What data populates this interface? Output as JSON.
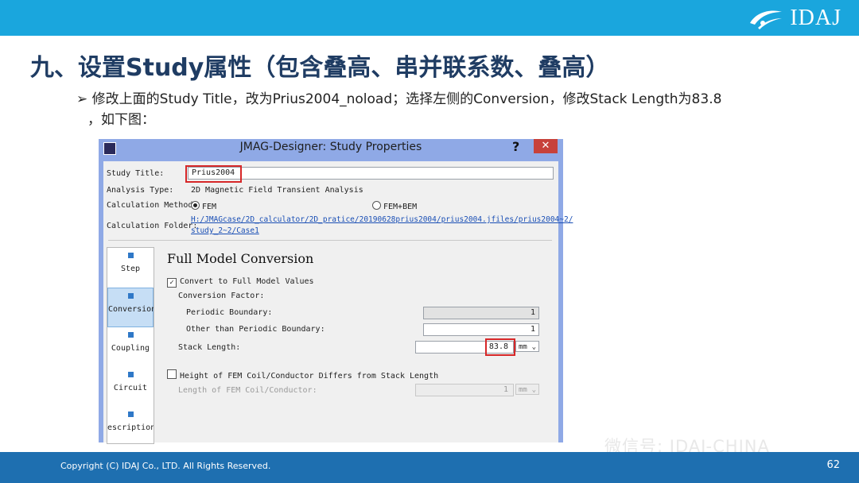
{
  "brand": {
    "logo_text": "IDAJ",
    "logo_icon": "idaj-swoosh-icon"
  },
  "slide": {
    "title": "九、设置Study属性（包含叠高、串并联系数、叠高）",
    "bullet_marker": "➢",
    "bullet_line1": "修改上面的Study Title，改为Prius2004_noload；选择左侧的Conversion，修改Stack Length为83.8",
    "bullet_line2": "，如下图："
  },
  "dialog": {
    "title": "JMAG-Designer: Study Properties",
    "help_label": "?",
    "close_label": "✕",
    "study_title_label": "Study Title:",
    "study_title_value": "Prius2004",
    "analysis_type_label": "Analysis Type:",
    "analysis_type_value": "2D Magnetic Field Transient Analysis",
    "calc_method_label": "Calculation Method:",
    "method_fem": "FEM",
    "method_fem_bem": "FEM+BEM",
    "calc_folder_label": "Calculation Folder:",
    "calc_folder_line1": "H:/JMAGcase/2D_calculator/2D_pratice/20190628prius2004/prius2004.jfiles/prius2004~2/",
    "calc_folder_line2": "study_2~2/Case1",
    "nav_items": [
      "Step",
      "Conversion",
      "Coupling",
      "Circuit",
      "Description"
    ],
    "nav_active": "Conversion",
    "panel": {
      "title": "Full Model Conversion",
      "convert_label": "Convert to Full Model Values",
      "convert_checked": true,
      "conversion_factor_label": "Conversion Factor:",
      "periodic_label": "Periodic Boundary:",
      "periodic_value": "1",
      "other_label": "Other than Periodic Boundary:",
      "other_value": "1",
      "stack_label": "Stack Length:",
      "stack_value": "83.8",
      "stack_unit": "mm",
      "height_label": "Height of FEM Coil/Conductor Differs from Stack Length",
      "height_checked": false,
      "length_label": "Length of FEM Coil/Conductor:",
      "length_value": "1",
      "length_unit": "mm"
    }
  },
  "footer": {
    "copyright": "Copyright (C) IDAJ Co., LTD. All Rights Reserved.",
    "page_number": "62",
    "watermark": "微信号: IDAJ-CHINA"
  },
  "colors": {
    "top_bar": "#1aa6dd",
    "bottom_bar": "#1e6fb0",
    "title_text": "#1f3c63",
    "highlight_box": "#d62728"
  }
}
